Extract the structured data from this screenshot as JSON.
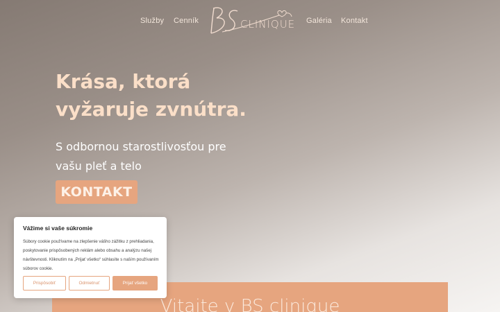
{
  "nav": {
    "items": [
      {
        "label": "Služby"
      },
      {
        "label": "Cenník"
      },
      {
        "label": "Galéria"
      },
      {
        "label": "Kontakt"
      }
    ],
    "logo_monogram": "BS",
    "logo_text": "CLINIQUE"
  },
  "hero": {
    "title_line1": "Krása, ktorá",
    "title_line2": "vyžaruje zvnútra.",
    "subtitle_line1": "S odbornou starostlivosťou pre",
    "subtitle_line2": "vašu pleť a telo",
    "button_label": "KONTAKT"
  },
  "welcome": {
    "title": "Vitajte v BS clinique"
  },
  "cookie": {
    "title": "Vážime si vaše súkromie",
    "body": "Súbory cookie používame na zlepšenie vášho zážitku z prehliadania, poskytovanie prispôsobených reklám alebo obsahu a analýzu našej návštevnosti. Kliknutím na „Prijať všetko“ súhlasíte s naším používaním súborov cookie.",
    "customize_label": "Prispôsobiť",
    "reject_label": "Odmietnuť",
    "accept_label": "Prijať všetko"
  },
  "colors": {
    "accent": "#e6a57f",
    "title": "#fbdfc8"
  }
}
